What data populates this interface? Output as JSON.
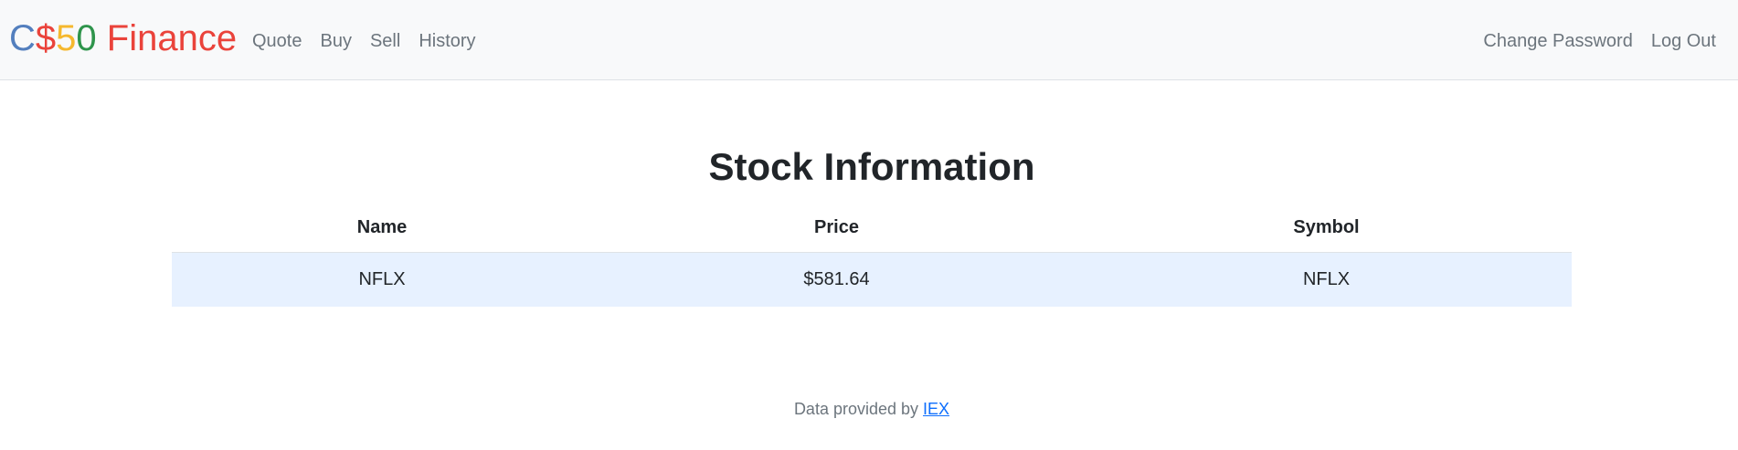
{
  "brand": {
    "part_c": "C",
    "part_dollar": "$",
    "part_5": "5",
    "part_0": "0",
    "part_finance": " Finance"
  },
  "nav": {
    "left": [
      {
        "label": "Quote"
      },
      {
        "label": "Buy"
      },
      {
        "label": "Sell"
      },
      {
        "label": "History"
      }
    ],
    "right": [
      {
        "label": "Change Password"
      },
      {
        "label": "Log Out"
      }
    ]
  },
  "main": {
    "title": "Stock Information",
    "table": {
      "headers": [
        "Name",
        "Price",
        "Symbol"
      ],
      "rows": [
        [
          "NFLX",
          "$581.64",
          "NFLX"
        ]
      ]
    }
  },
  "footer": {
    "text": "Data provided by ",
    "link": "IEX"
  },
  "colors": {
    "brand_blue": "#537fbe",
    "brand_red": "#ea433b",
    "brand_yellow": "#f5b82e",
    "brand_green": "#2e944b",
    "row_highlight": "#e7f1ff",
    "link": "#0d6efd"
  }
}
